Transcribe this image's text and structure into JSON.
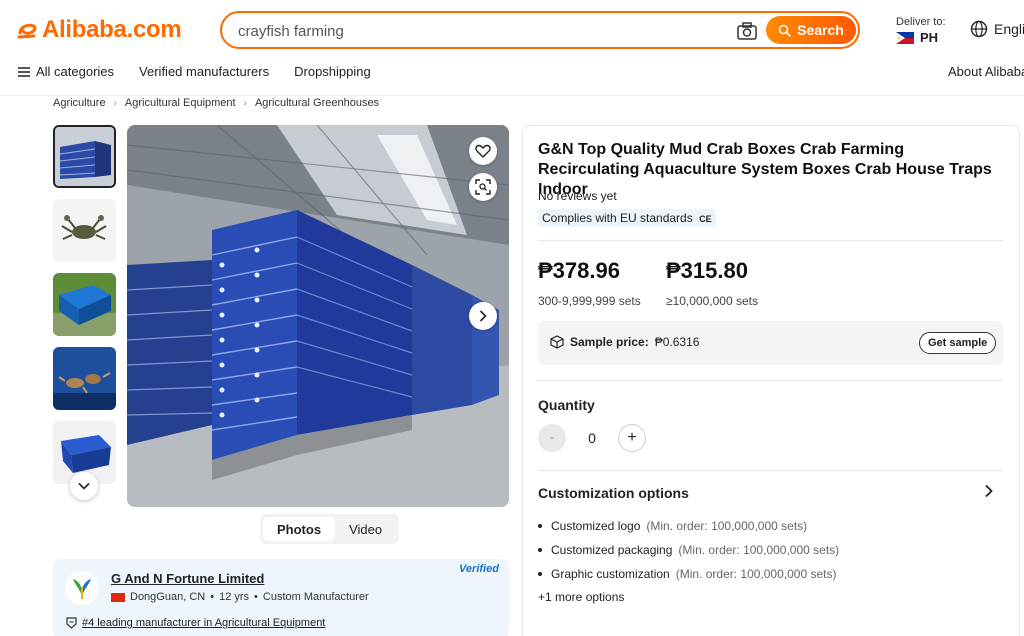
{
  "header": {
    "logo_text": "Alibaba.com",
    "search_value": "crayfish farming",
    "search_button": "Search",
    "deliver_label": "Deliver to:",
    "deliver_country": "PH",
    "language": "Engli",
    "accent": "#ff6a00"
  },
  "nav": {
    "all_categories": "All categories",
    "verified": "Verified manufacturers",
    "dropshipping": "Dropshipping",
    "about": "About Alibaba"
  },
  "breadcrumb": [
    "Agriculture",
    "Agricultural Equipment",
    "Agricultural Greenhouses"
  ],
  "media": {
    "tab_photos": "Photos",
    "tab_video": "Video"
  },
  "product": {
    "title": "G&N Top Quality Mud Crab Boxes Crab Farming Recirculating Aquaculture System Boxes Crab House Traps Indoor",
    "reviews": "No reviews yet",
    "compliance": "Complies with EU standards",
    "compliance_mark": "CE",
    "prices": [
      {
        "value": "₱378.96",
        "range": "300-9,999,999 sets"
      },
      {
        "value": "₱315.80",
        "range": "≥10,000,000 sets"
      }
    ],
    "sample_label": "Sample price:",
    "sample_value": "₱0.6316",
    "get_sample": "Get sample",
    "quantity_label": "Quantity",
    "quantity_value": "0",
    "qty_minus": "-",
    "qty_plus": "+",
    "custom_title": "Customization options",
    "custom_options": [
      {
        "name": "Customized logo",
        "min": "(Min. order: 100,000,000 sets)"
      },
      {
        "name": "Customized packaging",
        "min": "(Min. order: 100,000,000 sets)"
      },
      {
        "name": "Graphic customization",
        "min": "(Min. order: 100,000,000 sets)"
      }
    ],
    "more_options": "+1 more options"
  },
  "supplier": {
    "name": "G And N Fortune Limited",
    "location": "DongGuan, CN",
    "years": "12 yrs",
    "type": "Custom Manufacturer",
    "verified": "Verified",
    "rank": "#4 leading manufacturer in Agricultural Equipment",
    "meta_sep": "•"
  }
}
